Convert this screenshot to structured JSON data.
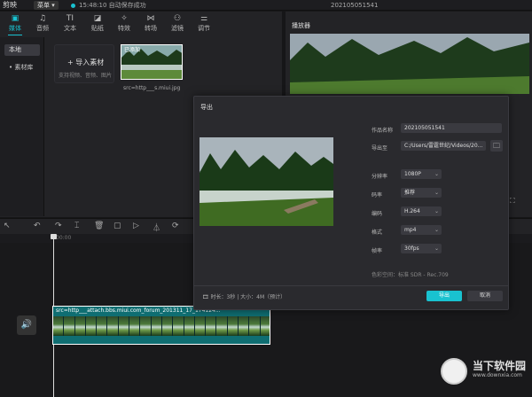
{
  "app": {
    "logo": "剪映",
    "menu": "菜单",
    "save_status": "15:48:10 自动保存成功",
    "title": "202105051541"
  },
  "toolbar": [
    {
      "icon": "▣",
      "label": "媒体",
      "name": "tool-media"
    },
    {
      "icon": "♫",
      "label": "音频",
      "name": "tool-audio"
    },
    {
      "icon": "TI",
      "label": "文本",
      "name": "tool-text"
    },
    {
      "icon": "◪",
      "label": "贴纸",
      "name": "tool-sticker"
    },
    {
      "icon": "✧",
      "label": "特效",
      "name": "tool-effects"
    },
    {
      "icon": "⋈",
      "label": "转场",
      "name": "tool-transition"
    },
    {
      "icon": "⚇",
      "label": "滤镜",
      "name": "tool-filter"
    },
    {
      "icon": "⚌",
      "label": "调节",
      "name": "tool-adjust"
    }
  ],
  "sidenav": {
    "local": "本地",
    "library": "素材库"
  },
  "media": {
    "import_label": "+ 导入素材",
    "import_sub": "支持视频、音频、图片",
    "thumb_tag": "已添加",
    "thumb_name": "src=http___s.miui.jpg"
  },
  "player": {
    "title": "播放器"
  },
  "timeline": {
    "ruler_start": "00:00",
    "clip_label": "src=http___attach.bbs.miui.com_forum_201311_17_174124..."
  },
  "export": {
    "title": "导出",
    "name_label": "作品名称",
    "name_value": "202105051541",
    "path_label": "导出至",
    "path_value": "C:/Users/雷霆世纪/Videos/20...",
    "res_label": "分辨率",
    "res_value": "1080P",
    "bitrate_label": "码率",
    "bitrate_value": "推荐",
    "codec_label": "编码",
    "codec_value": "H.264",
    "format_label": "格式",
    "format_value": "mp4",
    "fps_label": "帧率",
    "fps_value": "30fps",
    "color_space": "色彩空间：标准 SDR - Rec.709",
    "info": "时长：3秒 | 大小：4M（预计）",
    "export_btn": "导出",
    "cancel_btn": "取消"
  },
  "watermark": {
    "name": "当下软件园",
    "url": "www.downxia.com"
  }
}
